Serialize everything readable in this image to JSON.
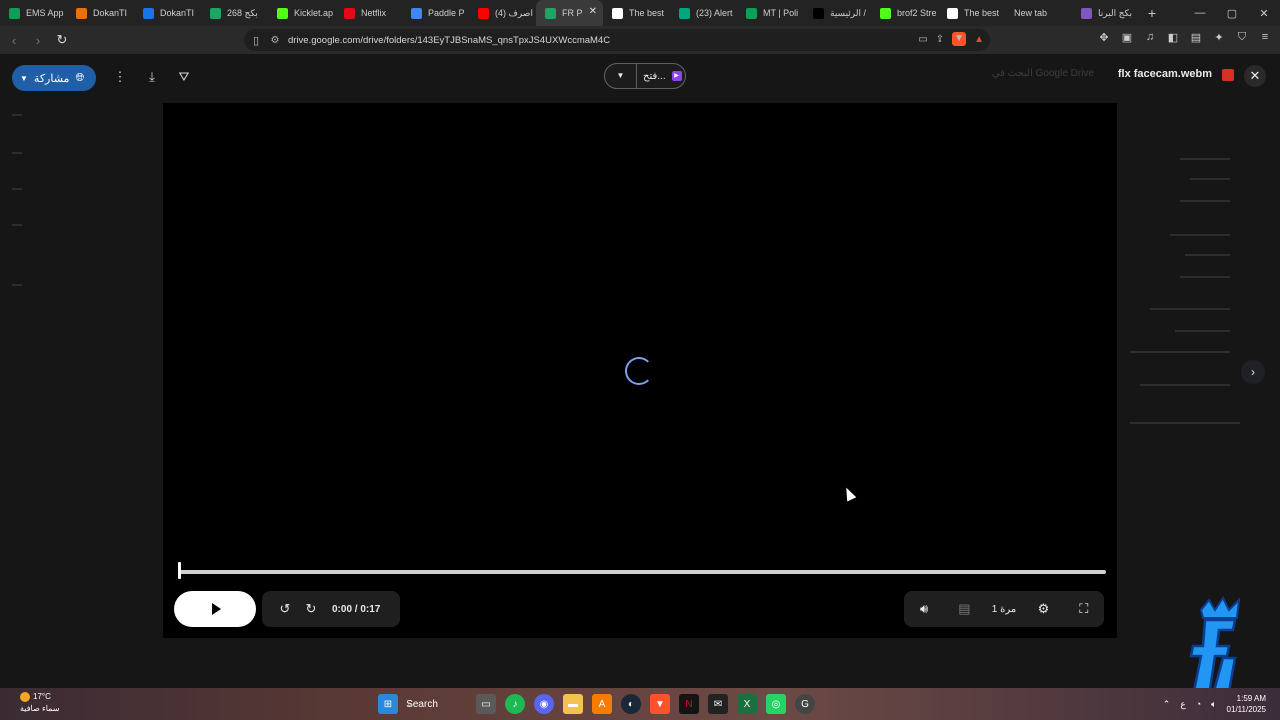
{
  "browser": {
    "tabs": [
      {
        "label": "EMS App",
        "icon": "sheets-icon",
        "color": "#0f9d58"
      },
      {
        "label": "DokanTI",
        "icon": "dokan-icon",
        "color": "#e8710a"
      },
      {
        "label": "DokanTI",
        "icon": "dokan-icon",
        "color": "#1a73e8"
      },
      {
        "label": "بكج 268",
        "icon": "drive-icon",
        "color": "#1fa463"
      },
      {
        "label": "Kicklet.ap",
        "icon": "kicklet-icon",
        "color": "#53fc18"
      },
      {
        "label": "Netflix",
        "icon": "netflix-icon",
        "color": "#e50914"
      },
      {
        "label": "Paddle P",
        "icon": "google-icon",
        "color": "#4285f4"
      },
      {
        "label": "(4) اصرف",
        "icon": "youtube-icon",
        "color": "#ff0000"
      },
      {
        "label": "FR P",
        "icon": "drive-icon",
        "color": "#1fa463",
        "active": true,
        "close": "✕"
      },
      {
        "label": "The best",
        "icon": "notion-icon",
        "color": "#ffffff"
      },
      {
        "label": "(23) Alert",
        "icon": "app-icon",
        "color": "#00a67e"
      },
      {
        "label": "MT | Poli",
        "icon": "sheets-icon",
        "color": "#0f9d58"
      },
      {
        "label": "الرئيسية /",
        "icon": "x-icon",
        "color": "#000000"
      },
      {
        "label": "brof2 Stre",
        "icon": "kick-icon",
        "color": "#53fc18"
      },
      {
        "label": "The best",
        "icon": "notion-icon",
        "color": "#ffffff"
      },
      {
        "label": "New tab",
        "icon": "",
        "color": ""
      },
      {
        "label": "بكج البرنا",
        "icon": "docs-icon",
        "color": "#7e57c2"
      }
    ],
    "newtab_glyph": "+",
    "window_controls": [
      "—",
      "▢",
      "✕"
    ],
    "url": "drive.google.com/drive/folders/143EyTJBSnaMS_qnsTpxJS4UXWccmaM4C"
  },
  "drive": {
    "share_label": "مشاركة",
    "open_with_label": "فتح...",
    "file_name": "flx facecam.webm",
    "search_placeholder": "البحث في Google Drive"
  },
  "player": {
    "time": "0:00 / 0:17",
    "speed": "1 مرة",
    "progress": 0.0
  },
  "taskbar": {
    "temperature": "17°C",
    "weather": "سماء صافية",
    "search_label": "Search",
    "time": "1:59 AM",
    "date": "01/11/2025",
    "lang": "ع"
  }
}
